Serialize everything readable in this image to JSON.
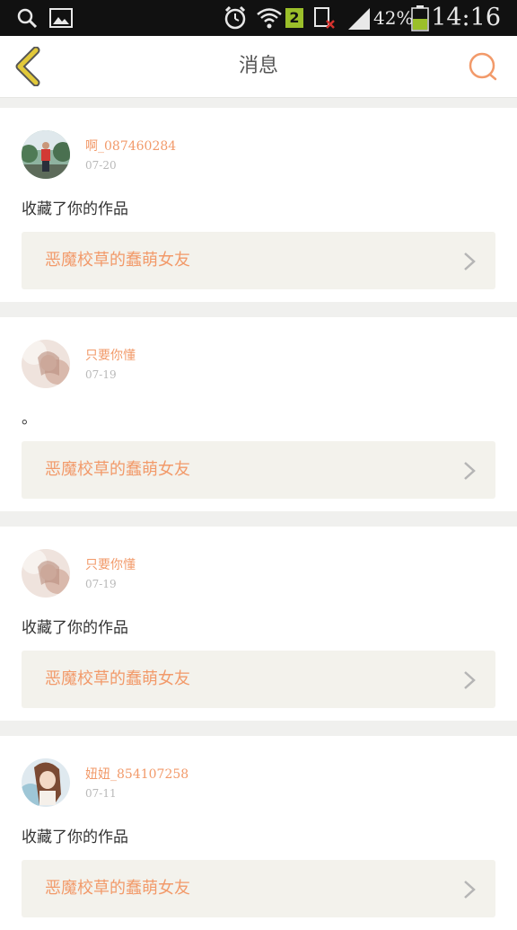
{
  "status_bar": {
    "battery_percent": "42%",
    "sim_number": "2",
    "time": "14:16"
  },
  "header": {
    "title": "消息"
  },
  "feed": [
    {
      "username": "啊_087460284",
      "date": "07-20",
      "action": "收藏了你的作品",
      "work_title": "恶魔校草的蠢萌女友"
    },
    {
      "username": "只要你懂",
      "date": "07-19",
      "action": "。",
      "work_title": "恶魔校草的蠢萌女友"
    },
    {
      "username": "只要你懂",
      "date": "07-19",
      "action": "收藏了你的作品",
      "work_title": "恶魔校草的蠢萌女友"
    },
    {
      "username": "妞妞_854107258",
      "date": "07-11",
      "action": "收藏了你的作品",
      "work_title": "恶魔校草的蠢萌女友"
    }
  ],
  "colors": {
    "accent": "#f29a6a",
    "back_icon": "#e2c93a",
    "card_link_bg": "#f3f2ec"
  },
  "icons": [
    "search-icon",
    "gallery-icon",
    "alarm-icon",
    "wifi-icon",
    "sim-icon",
    "no-sim-icon",
    "signal-icon",
    "battery-icon",
    "back-icon",
    "search-icon",
    "chevron-right-icon"
  ]
}
